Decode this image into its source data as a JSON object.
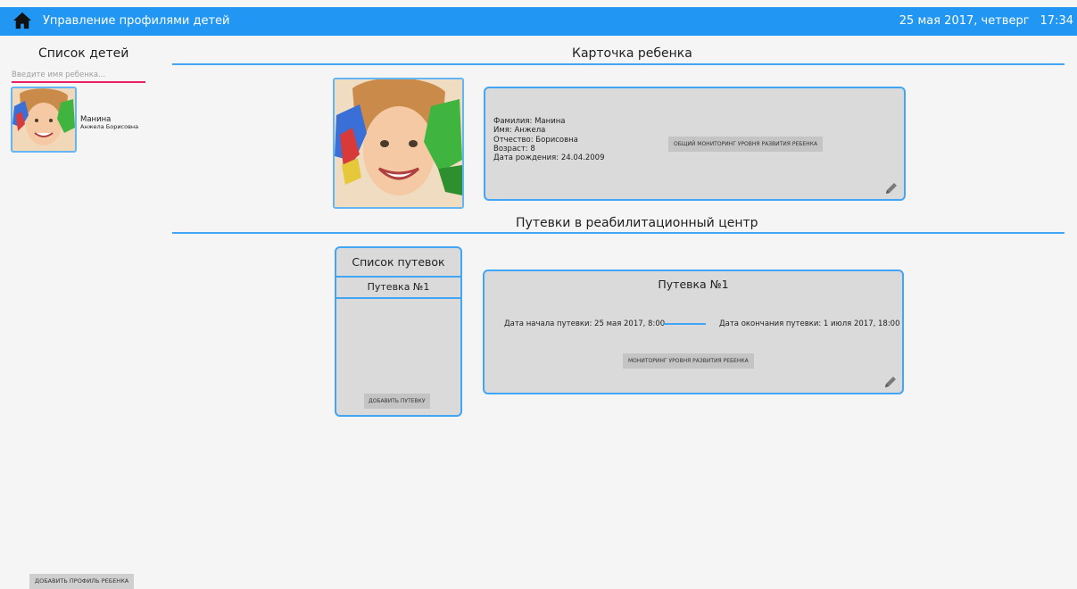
{
  "header": {
    "title": "Управление профилями детей",
    "date": "25 мая 2017, четверг",
    "time": "17:34",
    "home_icon": "home-icon"
  },
  "sidebar": {
    "title": "Список детей",
    "search_placeholder": "Введите имя ребенка...",
    "children": [
      {
        "surname": "Манина",
        "given_names": "Анжела Борисовна"
      }
    ],
    "add_profile_label": "ДОБАВИТЬ ПРОФИЛЬ РЕБЕНКА"
  },
  "child_card": {
    "title": "Карточка ребенка",
    "lines": [
      "Фамилия: Манина",
      "Имя: Анжела",
      "Отчество: Борисовна",
      "Возраст: 8",
      "Дата рождения: 24.04.2009"
    ],
    "monitoring_label": "ОБЩИЙ МОНИТОРИНГ УРОВНЯ РАЗВИТИЯ РЕБЕНКА",
    "edit_icon": "pencil-icon"
  },
  "trips": {
    "title": "Путевки в реабилитационный центр",
    "list_title": "Список путевок",
    "items": [
      "Путевка №1"
    ],
    "add_label": "ДОБАВИТЬ ПУТЕВКУ",
    "selected": {
      "title": "Путевка №1",
      "start": "Дата начала путевки: 25 мая 2017, 8:00",
      "end": "Дата окончания путевки: 1 июля 2017, 18:00",
      "monitoring_label": "МОНИТОРИНГ УРОВНЯ РАЗВИТИЯ РЕБЕНКА",
      "edit_icon": "pencil-icon"
    }
  },
  "colors": {
    "accent": "#2196f3",
    "border": "#42a5f5",
    "search_underline": "#e91e63",
    "card_bg": "#dadada"
  }
}
